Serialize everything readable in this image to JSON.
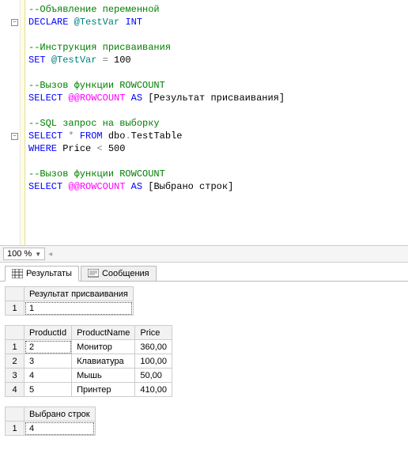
{
  "zoom": "100 %",
  "code": {
    "l1": "--Объявление переменной",
    "l2_declare": "DECLARE",
    "l2_var": "@TestVar",
    "l2_type": "INT",
    "l4": "--Инструкция присваивания",
    "l5_set": "SET",
    "l5_var": "@TestVar",
    "l5_eq": "=",
    "l5_val": "100",
    "l7": "--Вызов функции ROWCOUNT",
    "l8_select": "SELECT",
    "l8_sysvar": "@@ROWCOUNT",
    "l8_as": "AS",
    "l8_alias": "[Результат присваивания]",
    "l10": "--SQL запрос на выборку",
    "l11_select": "SELECT",
    "l11_star": "*",
    "l11_from": "FROM",
    "l11_schema": "dbo",
    "l11_dot": ".",
    "l11_table": "TestTable",
    "l12_where": "WHERE",
    "l12_col": "Price",
    "l12_op": "<",
    "l12_val": "500",
    "l14": "--Вызов функции ROWCOUNT",
    "l15_select": "SELECT",
    "l15_sysvar": "@@ROWCOUNT",
    "l15_as": "AS",
    "l15_alias": "[Выбрано строк]"
  },
  "tabs": {
    "results": "Результаты",
    "messages": "Сообщения"
  },
  "grid1": {
    "header": "Результат присваивания",
    "row1_num": "1",
    "row1_val": "1"
  },
  "grid2": {
    "h1": "ProductId",
    "h2": "ProductName",
    "h3": "Price",
    "rows": {
      "r1": {
        "n": "1",
        "c1": "2",
        "c2": "Монитор",
        "c3": "360,00"
      },
      "r2": {
        "n": "2",
        "c1": "3",
        "c2": "Клавиатура",
        "c3": "100,00"
      },
      "r3": {
        "n": "3",
        "c1": "4",
        "c2": "Мышь",
        "c3": "50,00"
      },
      "r4": {
        "n": "4",
        "c1": "5",
        "c2": "Принтер",
        "c3": "410,00"
      }
    }
  },
  "grid3": {
    "header": "Выбрано строк",
    "row1_num": "1",
    "row1_val": "4"
  },
  "chart_data": {
    "type": "table",
    "tables": [
      {
        "columns": [
          "Результат присваивания"
        ],
        "rows": [
          [
            1
          ]
        ]
      },
      {
        "columns": [
          "ProductId",
          "ProductName",
          "Price"
        ],
        "rows": [
          [
            2,
            "Монитор",
            360.0
          ],
          [
            3,
            "Клавиатура",
            100.0
          ],
          [
            4,
            "Мышь",
            50.0
          ],
          [
            5,
            "Принтер",
            410.0
          ]
        ]
      },
      {
        "columns": [
          "Выбрано строк"
        ],
        "rows": [
          [
            4
          ]
        ]
      }
    ]
  }
}
